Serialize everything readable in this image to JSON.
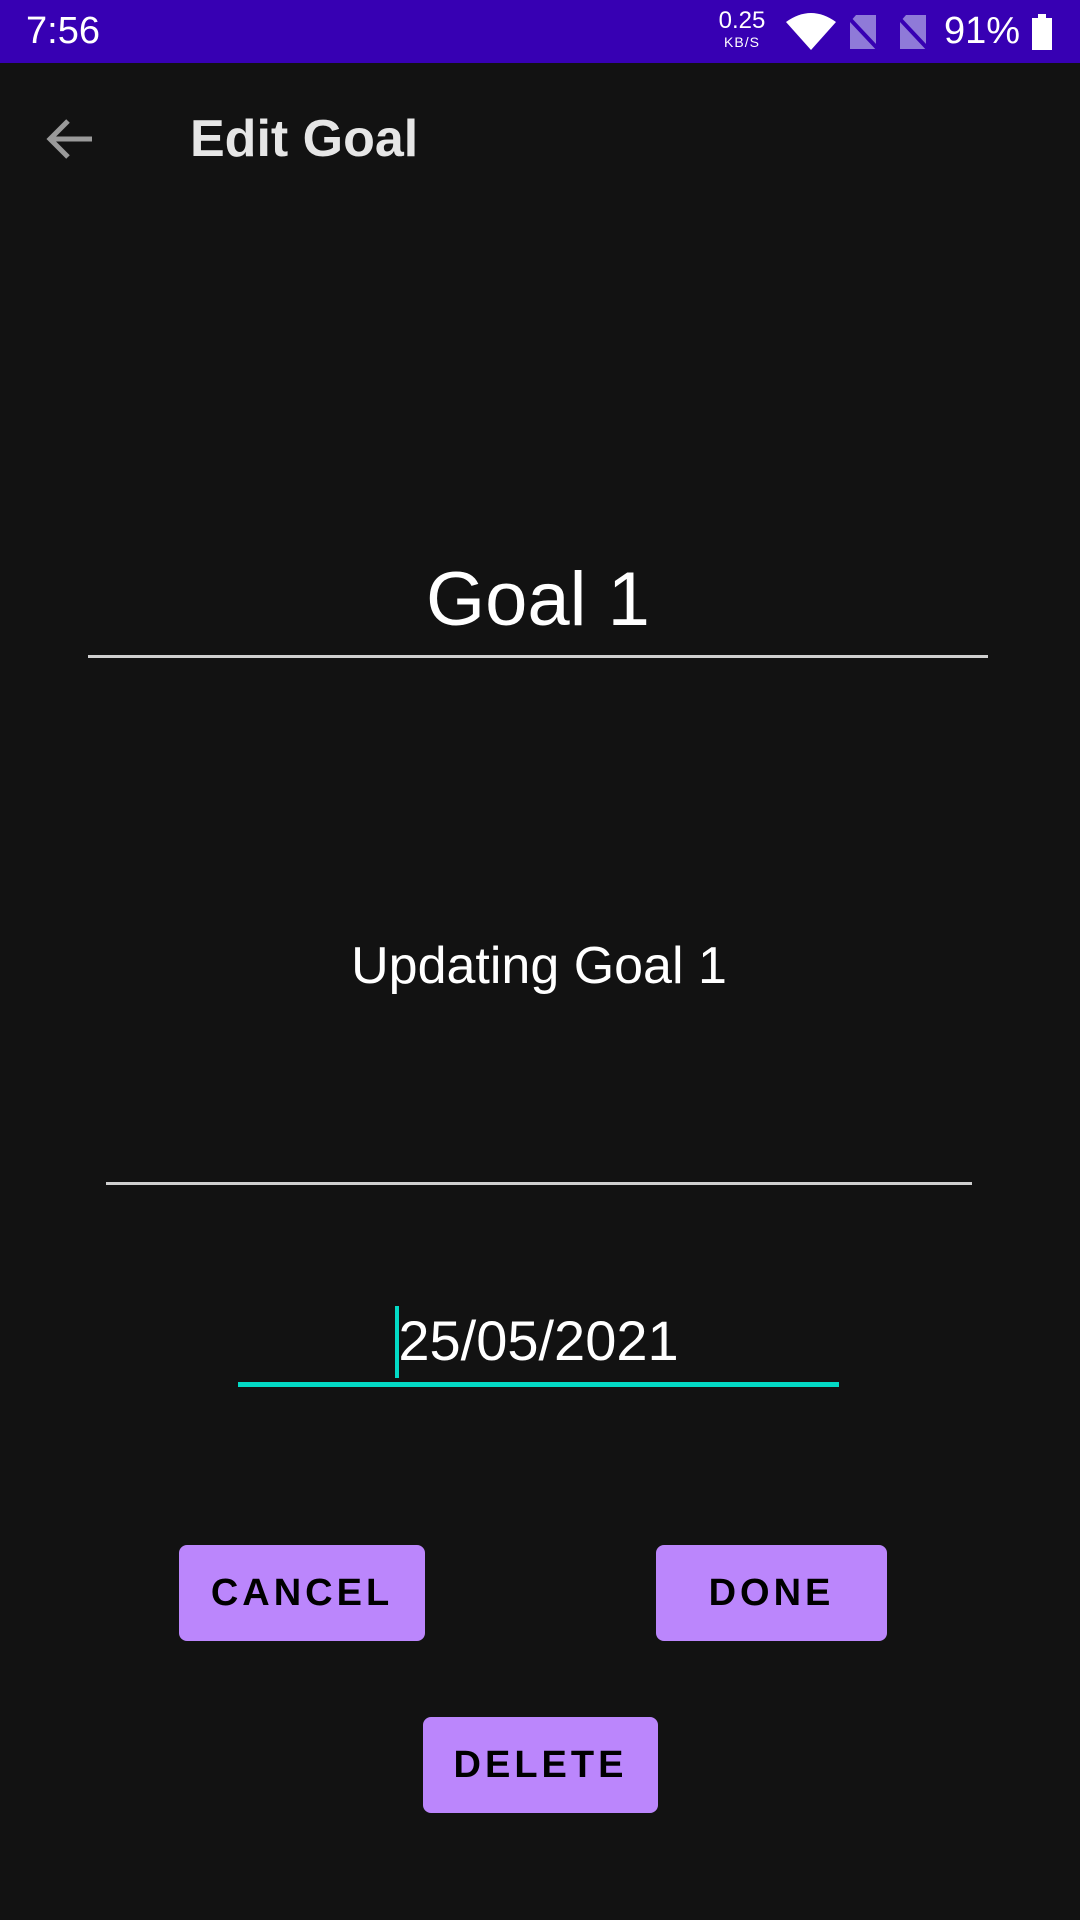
{
  "status_bar": {
    "time": "7:56",
    "net_speed_value": "0.25",
    "net_speed_unit": "KB/S",
    "battery": "91%",
    "icons": [
      "wifi-icon",
      "sim-off-icon",
      "sim-off-icon",
      "battery-icon"
    ]
  },
  "app_bar": {
    "title": "Edit Goal",
    "back_icon": "arrow-back-icon"
  },
  "form": {
    "goal_title": "Goal 1",
    "goal_description": "Updating Goal 1",
    "goal_date": "25/05/2021"
  },
  "actions": {
    "cancel_label": "CANCEL",
    "done_label": "DONE",
    "delete_label": "DELETE"
  },
  "colors": {
    "status_bar": "#3700b3",
    "background": "#121212",
    "button": "#bb86fc",
    "accent": "#03dac5"
  }
}
